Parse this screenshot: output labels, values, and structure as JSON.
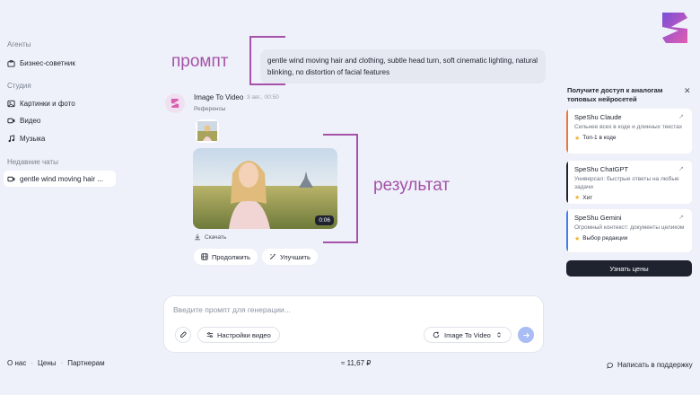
{
  "colors": {
    "accent": "#a552a8",
    "dark": "#1f2330",
    "send": "#a9bdf4"
  },
  "sidebar": {
    "agents_heading": "Агенты",
    "agent_item": "Бизнес-советник",
    "studio_heading": "Студия",
    "studio_items": [
      "Картинки и фото",
      "Видео",
      "Музыка"
    ],
    "recent_heading": "Недавние чаты",
    "recent_chat": "gentle wind moving hair ..."
  },
  "annotations": {
    "prompt": "промпт",
    "result": "результат"
  },
  "prompt_text": "gentle wind moving hair and clothing, subtle head turn, soft cinematic lighting, natural blinking, no distortion of facial features",
  "message": {
    "title": "Image To Video",
    "time": "3 авг., 00:50",
    "references_label": "Референсы",
    "video_duration": "0:06",
    "download_label": "Скачать",
    "continue_label": "Продолжить",
    "improve_label": "Улучшить"
  },
  "composer": {
    "placeholder": "Введите промпт для генерации...",
    "settings_label": "Настройки видео",
    "model_label": "Image To Video"
  },
  "promo": {
    "title": "Получите доступ к аналогам топовых нейросетей",
    "cards": [
      {
        "name": "SpeShu Claude",
        "desc": "Сильнее всех в коде и длинных текстах",
        "tag": "Топ-1 в коде",
        "color": "#e8793a"
      },
      {
        "name": "SpeShu ChatGPT",
        "desc": "Универсал: быстрые ответы на любые задачи",
        "tag": "Хит",
        "color": "#1f2330"
      },
      {
        "name": "SpeShu Gemini",
        "desc": "Огромный контекст: документы целиком",
        "tag": "Выбор редакции",
        "color": "#3d7ff0"
      }
    ],
    "cta": "Узнать цены"
  },
  "footer": {
    "about": "О нас",
    "prices": "Цены",
    "partners": "Партнерам",
    "balance": "≈ 11,67 ₽",
    "support": "Написать в поддержку"
  }
}
